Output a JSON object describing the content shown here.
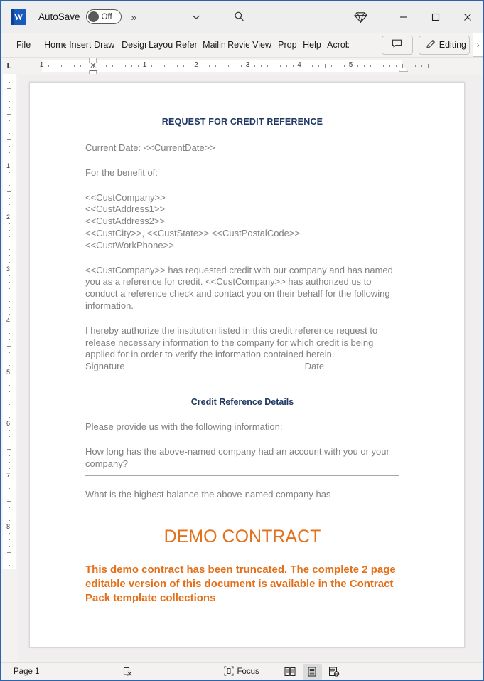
{
  "window": {
    "app_icon": "word-logo-icon",
    "autosave_label": "AutoSave",
    "autosave_state": "Off",
    "more_commands": "»",
    "quick_access_chevron": "chevron-down-icon",
    "search_icon": "search-icon",
    "premium_icon": "diamond-icon",
    "minimize": "minimize-icon",
    "maximize": "maximize-icon",
    "close": "close-icon"
  },
  "ribbon": {
    "tabs": [
      {
        "label": "File",
        "name": "tab-file"
      },
      {
        "label": "Home",
        "name": "tab-home"
      },
      {
        "label": "Insert",
        "name": "tab-insert"
      },
      {
        "label": "Draw",
        "name": "tab-draw"
      },
      {
        "label": "Design",
        "name": "tab-design"
      },
      {
        "label": "Layout",
        "name": "tab-layout"
      },
      {
        "label": "Refer",
        "name": "tab-references"
      },
      {
        "label": "Mailin",
        "name": "tab-mailings"
      },
      {
        "label": "Revie",
        "name": "tab-review"
      },
      {
        "label": "View",
        "name": "tab-view"
      },
      {
        "label": "Prop",
        "name": "tab-proposal"
      },
      {
        "label": "Help",
        "name": "tab-help"
      },
      {
        "label": "Acrob",
        "name": "tab-acrobat"
      }
    ],
    "comments_button": "comment-icon",
    "editing_button": "Editing",
    "editing_icon": "pencil-icon",
    "overflow_caret": "›"
  },
  "ruler": {
    "corner_label": "L",
    "horizontal_numbers": [
      "1",
      "2",
      "3",
      "4",
      "5"
    ],
    "vertical_numbers": [
      "1",
      "2",
      "3",
      "4",
      "5",
      "6",
      "7",
      "8"
    ]
  },
  "document": {
    "heading": "REQUEST FOR CREDIT REFERENCE",
    "current_date_line": "Current Date: <<CurrentDate>>",
    "benefit_line": "For the benefit of:",
    "address_block": [
      "<<CustCompany>>",
      "<<CustAddress1>>",
      "<<CustAddress2>>",
      "<<CustCity>>, <<CustState>> <<CustPostalCode>>",
      "<<CustWorkPhone>>"
    ],
    "paragraph_request": "<<CustCompany>> has requested credit with our company and has named you as a reference for credit. <<CustCompany>> has authorized us to conduct a reference check and contact you on their behalf for the following information.",
    "paragraph_authorize": "I hereby authorize the institution listed in this credit reference request to release necessary information to the company for which credit is being applied for in order to verify the information contained herein.",
    "signature_label": "Signature",
    "date_label": "Date",
    "subheading": "Credit Reference Details",
    "please_provide": "Please provide us with the following information:",
    "question_1": "How long has the above-named company had an account with you or your company?",
    "question_2": "What is the highest balance the above-named company has",
    "demo_title": "DEMO CONTRACT",
    "demo_note": "This demo contract has been truncated. The complete 2 page editable version of this document is available in the Contract Pack template collections"
  },
  "statusbar": {
    "page_label": "Page 1",
    "proofing_icon": "spelling-check-icon",
    "focus_label": "Focus",
    "focus_icon": "focus-icon",
    "view_read_icon": "read-mode-icon",
    "view_print_icon": "print-layout-icon",
    "view_web_icon": "web-layout-icon"
  },
  "colors": {
    "heading": "#1f3864",
    "body_text": "#808080",
    "demo_orange": "#e3701a",
    "word_blue": "#185abd",
    "window_border": "#2a63b0"
  }
}
